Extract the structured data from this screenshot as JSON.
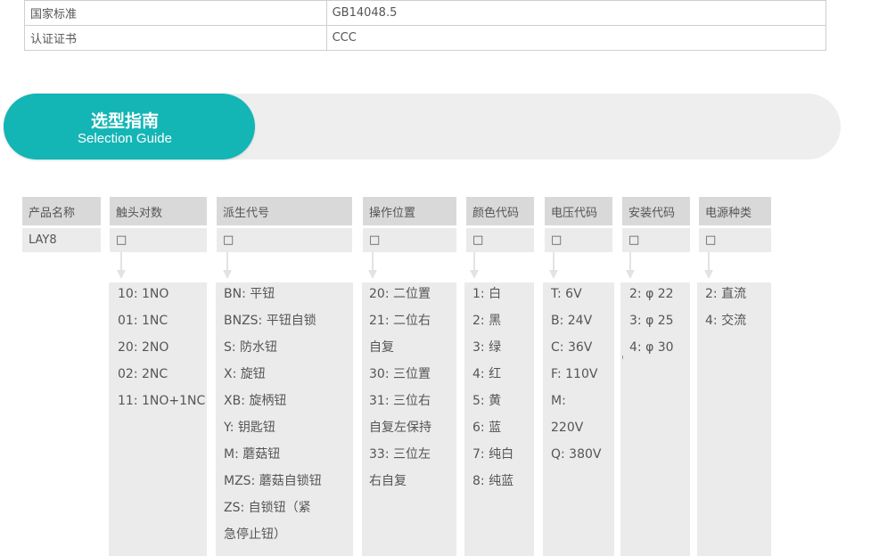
{
  "spec_table": {
    "rows": [
      {
        "key": "",
        "value": "",
        "extra": ""
      },
      {
        "key": "国家标准",
        "value": "GB14048.5",
        "extra": ""
      },
      {
        "key": "认证证书",
        "value": "CCC",
        "extra": ""
      }
    ]
  },
  "banner": {
    "title_cn": "选型指南",
    "title_en": "Selection Guide"
  },
  "columns": [
    {
      "header": "产品名称",
      "code": "LAY8",
      "items": []
    },
    {
      "header": "触头对数",
      "code": "□",
      "items": [
        "10: 1NO",
        "01: 1NC",
        "20: 2NO",
        "02: 2NC",
        "11: 1NO+1NC"
      ]
    },
    {
      "header": "派生代号",
      "code": "□",
      "items": [
        "BN:  平钮",
        "BNZS:  平钮自锁",
        "S:  防水钮",
        "X:  旋钮",
        "XB:  旋柄钮",
        "Y:  钥匙钮",
        "M:  蘑菇钮",
        "MZS:  蘑菇自锁钮",
        "ZS:  自锁钮（紧",
        "急停止钮）"
      ]
    },
    {
      "header": "操作位置",
      "code": "□",
      "items": [
        "20:  二位置",
        "21:  二位右",
        "自复",
        "30:  三位置",
        "31:  三位右",
        "自复左保持",
        "33:  三位左",
        "右自复"
      ]
    },
    {
      "header": "颜色代码",
      "code": "□",
      "items": [
        "1:  白",
        "2:  黑",
        "3:  绿",
        "4:  红",
        "5:  黄",
        "6:  蓝",
        "7:  纯白",
        "8:  纯蓝"
      ]
    },
    {
      "header": "电压代码",
      "code": "□",
      "items": [
        "T: 6V",
        "B: 24V",
        "C: 36V",
        "F: 110V",
        "M:",
        "220V",
        "Q: 380V"
      ]
    },
    {
      "header": "安装代码",
      "code": "□",
      "items": [
        "2:  φ 22",
        "3:  φ 25",
        "4:  φ 30"
      ]
    },
    {
      "header": "电源种类",
      "code": "□",
      "items": [
        "2:  直流",
        "4:  交流"
      ]
    }
  ],
  "colors": {
    "accent": "#14b5b5",
    "banner_bg": "#eeeeee",
    "header_bg": "#d9d9d9",
    "cell_bg": "#ebebeb"
  }
}
